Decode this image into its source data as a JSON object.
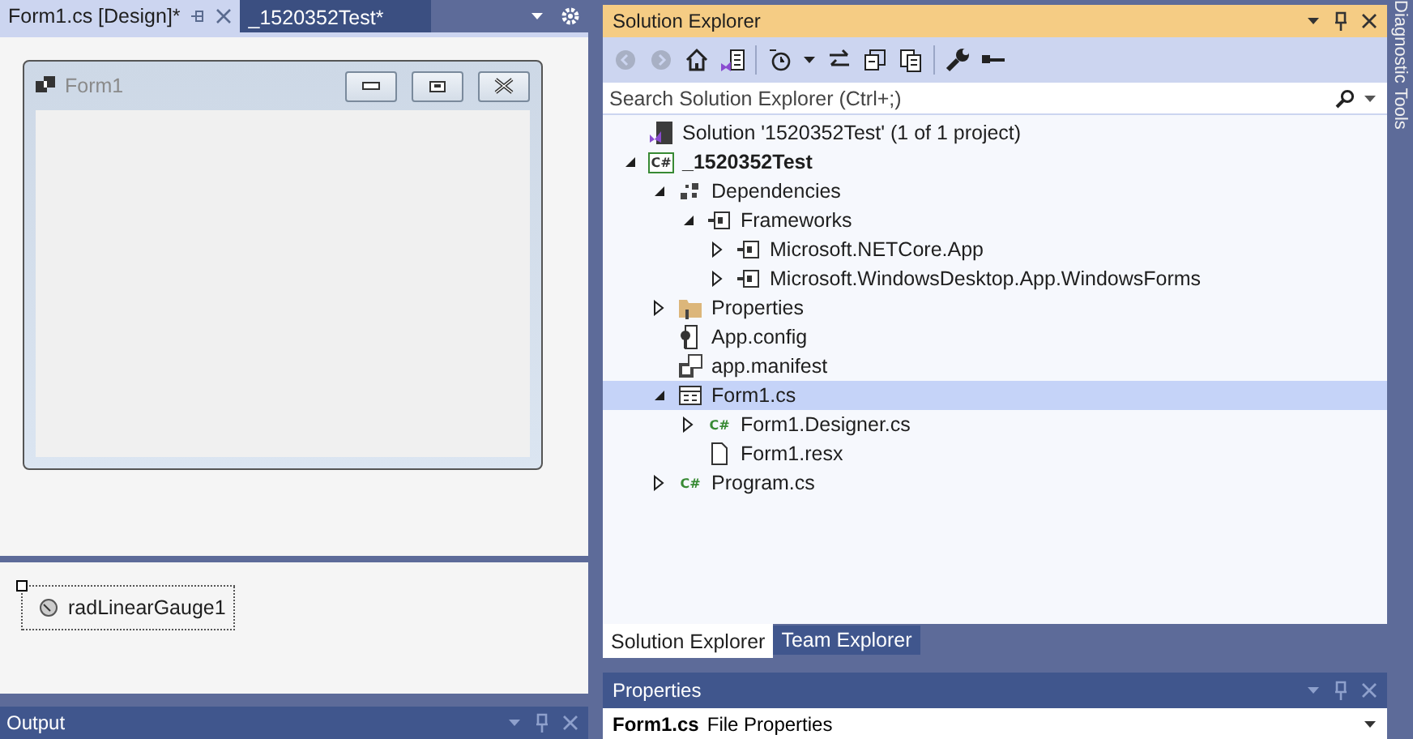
{
  "document_tabs": [
    {
      "label": "Form1.cs [Design]*",
      "selected": true
    },
    {
      "label": "_1520352Test*",
      "selected": false
    }
  ],
  "form_window": {
    "title": "Form1"
  },
  "component_tray": [
    {
      "label": "radLinearGauge1"
    }
  ],
  "output_panel": {
    "title": "Output"
  },
  "solution_explorer": {
    "title": "Solution Explorer",
    "search": {
      "placeholder": "Search Solution Explorer (Ctrl+;)"
    },
    "tree": [
      {
        "label": "Solution '1520352Test' (1 of 1 project)",
        "kind": "solution",
        "selected": false
      },
      {
        "label": "_1520352Test",
        "kind": "project",
        "badge": "C#",
        "selected": false,
        "expanded": true,
        "children": [
          {
            "label": "Dependencies",
            "kind": "dependencies",
            "selected": false,
            "expanded": true,
            "children": [
              {
                "label": "Frameworks",
                "kind": "frameworks",
                "selected": false,
                "expanded": true,
                "children": [
                  {
                    "label": "Microsoft.NETCore.App",
                    "kind": "package",
                    "selected": false,
                    "expanded": false
                  },
                  {
                    "label": "Microsoft.WindowsDesktop.App.WindowsForms",
                    "kind": "package",
                    "selected": false,
                    "expanded": false
                  }
                ]
              }
            ]
          },
          {
            "label": "Properties",
            "kind": "folder",
            "selected": false,
            "expanded": false
          },
          {
            "label": "App.config",
            "kind": "config",
            "selected": false
          },
          {
            "label": "app.manifest",
            "kind": "manifest",
            "selected": false
          },
          {
            "label": "Form1.cs",
            "kind": "form",
            "selected": true,
            "expanded": true,
            "children": [
              {
                "label": "Form1.Designer.cs",
                "kind": "csharp",
                "badge": "C#",
                "selected": false,
                "expanded": false
              },
              {
                "label": "Form1.resx",
                "kind": "file",
                "selected": false
              }
            ]
          },
          {
            "label": "Program.cs",
            "kind": "csharp",
            "badge": "C#",
            "selected": false,
            "expanded": false
          }
        ]
      }
    ],
    "bottom_tabs": [
      {
        "label": "Solution Explorer",
        "selected": true
      },
      {
        "label": "Team Explorer",
        "selected": false
      }
    ]
  },
  "properties_panel": {
    "title": "Properties",
    "object_name": "Form1.cs",
    "object_type": "File Properties"
  },
  "side_tab": {
    "label": "Diagnostic Tools"
  }
}
